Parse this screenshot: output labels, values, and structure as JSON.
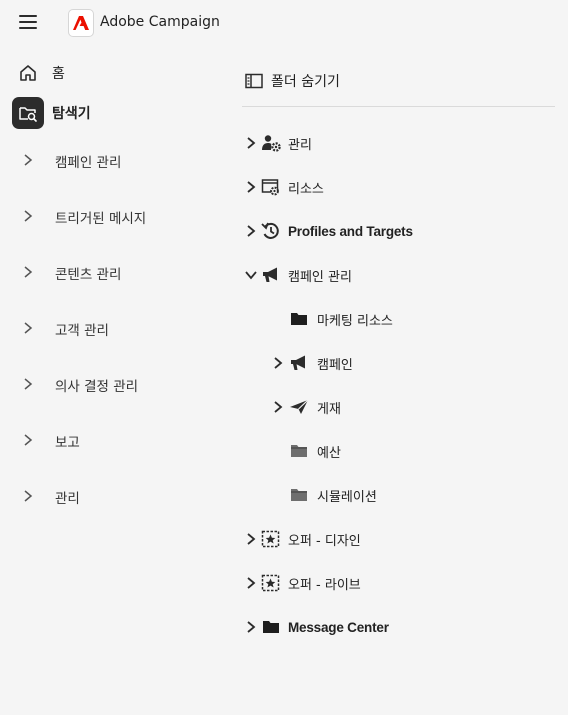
{
  "app": {
    "title": "Adobe Campaign"
  },
  "nav": {
    "home": "홈",
    "explorer": "탐색기",
    "items": [
      {
        "label": "캠페인 관리"
      },
      {
        "label": "트리거된 메시지"
      },
      {
        "label": "콘텐츠 관리"
      },
      {
        "label": "고객 관리"
      },
      {
        "label": "의사 결정 관리"
      },
      {
        "label": "보고"
      },
      {
        "label": "관리"
      }
    ]
  },
  "explorer": {
    "toggle_label": "폴더 숨기기",
    "tree": [
      {
        "label": "관리",
        "icon": "admin-gear-icon",
        "expandable": true,
        "expanded": false,
        "level": 0
      },
      {
        "label": "리소스",
        "icon": "resources-gear-icon",
        "expandable": true,
        "expanded": false,
        "level": 0
      },
      {
        "label": "Profiles and Targets",
        "icon": "profiles-icon",
        "expandable": true,
        "expanded": false,
        "level": 0
      },
      {
        "label": "캠페인 관리",
        "icon": "megaphone-icon",
        "expandable": true,
        "expanded": true,
        "level": 0
      },
      {
        "label": "마케팅 리소스",
        "icon": "folder-icon",
        "expandable": false,
        "expanded": false,
        "level": 1
      },
      {
        "label": "캠페인",
        "icon": "megaphone-icon",
        "expandable": true,
        "expanded": false,
        "level": 1
      },
      {
        "label": "게재",
        "icon": "paper-plane-icon",
        "expandable": true,
        "expanded": false,
        "level": 1
      },
      {
        "label": "예산",
        "icon": "folder-gray-icon",
        "expandable": false,
        "expanded": false,
        "level": 1
      },
      {
        "label": "시뮬레이션",
        "icon": "folder-gray-icon",
        "expandable": false,
        "expanded": false,
        "level": 1
      },
      {
        "label": "오퍼 - 디자인",
        "icon": "offer-star-icon",
        "expandable": true,
        "expanded": false,
        "level": 0
      },
      {
        "label": "오퍼 - 라이브",
        "icon": "offer-star-icon",
        "expandable": true,
        "expanded": false,
        "level": 0
      },
      {
        "label": "Message Center",
        "icon": "folder-icon",
        "expandable": true,
        "expanded": false,
        "level": 0
      }
    ]
  }
}
